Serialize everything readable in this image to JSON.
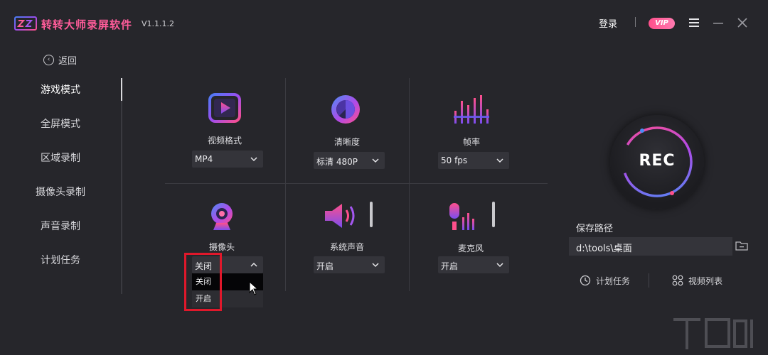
{
  "header": {
    "app_title": "转转大师录屏软件",
    "version": "V1.1.1.2",
    "login": "登录",
    "vip": "VIP"
  },
  "sidebar": {
    "back": "返回",
    "items": [
      {
        "label": "游戏模式",
        "active": true
      },
      {
        "label": "全屏模式"
      },
      {
        "label": "区域录制"
      },
      {
        "label": "摄像头录制"
      },
      {
        "label": "声音录制"
      },
      {
        "label": "计划任务"
      }
    ]
  },
  "settings": {
    "video_format": {
      "label": "视频格式",
      "value": "MP4",
      "icon": "play-icon"
    },
    "clarity": {
      "label": "清晰度",
      "value": "标清 480P",
      "icon": "clarity-icon"
    },
    "frame_rate": {
      "label": "帧率",
      "value": "50 fps",
      "icon": "equalizer-icon"
    },
    "camera": {
      "label": "摄像头",
      "value": "关闭",
      "icon": "webcam-icon",
      "dropdown_open": true,
      "options": [
        "关闭",
        "开启"
      ]
    },
    "system_sound": {
      "label": "系统声音",
      "value": "开启",
      "icon": "speaker-icon"
    },
    "microphone": {
      "label": "麦克风",
      "value": "开启",
      "icon": "microphone-icon"
    }
  },
  "record": {
    "rec_label": "REC",
    "save_path_title": "保存路径",
    "save_path": "d:\\tools\\桌面",
    "scheduled_task": "计划任务",
    "video_list": "视频列表"
  },
  "colors": {
    "accent_pink": "#ff4f8b",
    "accent_purple": "#8a5cf6",
    "accent_blue": "#4b8cf5",
    "background": "#26262b",
    "highlight_red": "#e0182b"
  }
}
